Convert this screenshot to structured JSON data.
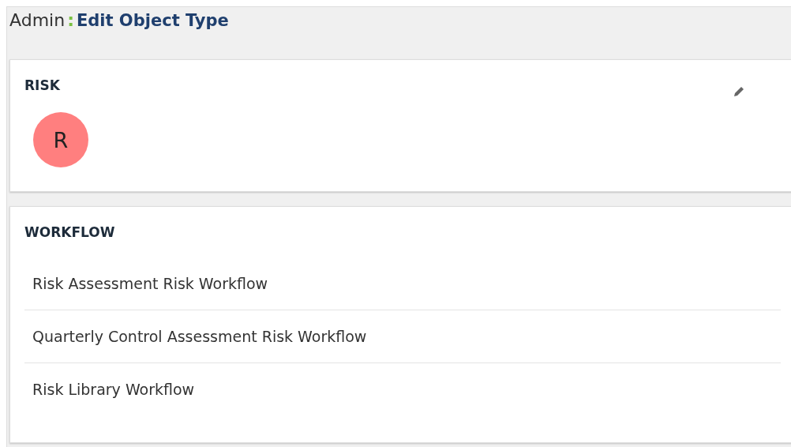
{
  "header": {
    "parent": "Admin",
    "separator": ":",
    "title": "Edit Object Type"
  },
  "object_card": {
    "title": "RISK",
    "avatar": {
      "letter": "R",
      "color": "#ff7f7f"
    }
  },
  "workflow_card": {
    "title": "WORKFLOW",
    "items": [
      {
        "label": "Risk Assessment Risk Workflow"
      },
      {
        "label": "Quarterly Control Assessment Risk Workflow"
      },
      {
        "label": "Risk Library Workflow"
      }
    ]
  }
}
